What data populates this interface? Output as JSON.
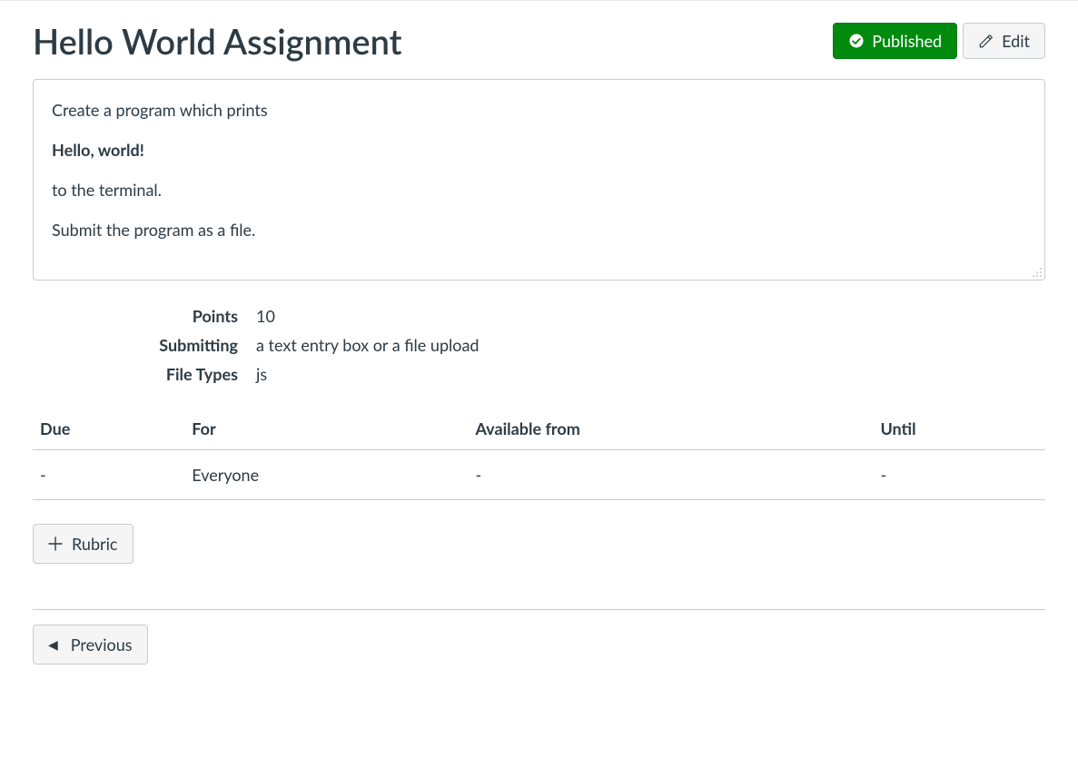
{
  "header": {
    "title": "Hello World Assignment",
    "published_label": "Published",
    "edit_label": "Edit"
  },
  "description": {
    "line1": "Create a program which prints",
    "line2_bold": "Hello, world!",
    "line3": "to the terminal.",
    "line4": "Submit the program as a file."
  },
  "meta": {
    "points_label": "Points",
    "points_value": "10",
    "submitting_label": "Submitting",
    "submitting_value": "a text entry box or a file upload",
    "file_types_label": "File Types",
    "file_types_value": "js"
  },
  "dates_table": {
    "headers": {
      "due": "Due",
      "for": "For",
      "from": "Available from",
      "until": "Until"
    },
    "row": {
      "due": "-",
      "for": "Everyone",
      "from": "-",
      "until": "-"
    }
  },
  "rubric_button": "Rubric",
  "previous_button": "Previous"
}
